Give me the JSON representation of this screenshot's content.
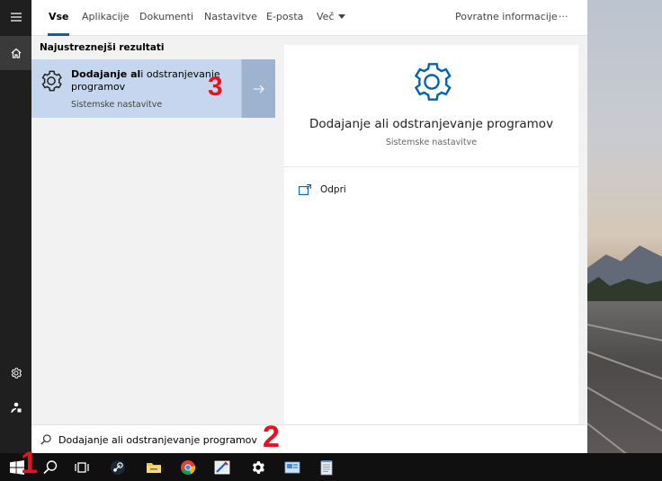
{
  "tabs": {
    "all": "Vse",
    "apps": "Aplikacije",
    "documents": "Dokumenti",
    "settings": "Nastavitve",
    "email": "E-posta",
    "more": "Več",
    "feedback": "Povratne informacije",
    "ellipsis": "···"
  },
  "results": {
    "heading": "Najustreznejši rezultati",
    "best_match": {
      "title_bold": "Dodajanje al",
      "title_rest": "i odstranjevanje programov",
      "subtitle": "Sistemske nastavitve",
      "icon": "gear-icon"
    }
  },
  "preview": {
    "title": "Dodajanje ali odstranjevanje programov",
    "subtitle": "Sistemske nastavitve",
    "open_label": "Odpri"
  },
  "search": {
    "value": "Dodajanje ali odstranjevanje programov"
  },
  "markers": {
    "one": "1",
    "two": "2",
    "three": "3"
  },
  "colors": {
    "accent": "#0063b1",
    "selected_result": "#c5d6ee",
    "marker": "#e8121d"
  }
}
